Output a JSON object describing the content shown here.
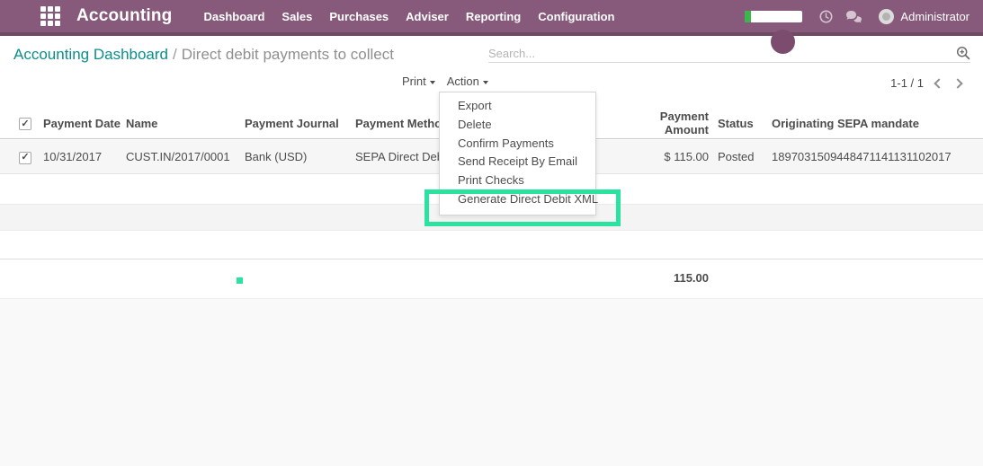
{
  "nav": {
    "brand": "Accounting",
    "items": [
      "Dashboard",
      "Sales",
      "Purchases",
      "Adviser",
      "Reporting",
      "Configuration"
    ],
    "user": "Administrator"
  },
  "breadcrumb": {
    "parent": "Accounting Dashboard",
    "separator": "/",
    "current": "Direct debit payments to collect"
  },
  "search": {
    "placeholder": "Search..."
  },
  "toolbar": {
    "print_label": "Print",
    "action_label": "Action"
  },
  "pager": {
    "range": "1-1 / 1"
  },
  "action_menu": {
    "items": [
      "Export",
      "Delete",
      "Confirm Payments",
      "Send Receipt By Email",
      "Print Checks",
      "Generate Direct Debit XML"
    ],
    "highlighted": "Generate Direct Debit XML"
  },
  "table": {
    "headers": [
      "Payment Date",
      "Name",
      "Payment Journal",
      "Payment Method",
      "Payment Amount",
      "Status",
      "Originating SEPA mandate"
    ],
    "rows": [
      {
        "payment_date": "10/31/2017",
        "name": "CUST.IN/2017/0001",
        "payment_journal": "Bank (USD)",
        "payment_method": "SEPA Direct Debit",
        "payment_amount": "$ 115.00",
        "status": "Posted",
        "mandate": "1897031509448471141131102017"
      }
    ],
    "total_amount": "115.00"
  },
  "icons": {
    "apps": "grid-3x3",
    "clock": "clock",
    "chat": "speech-bubbles",
    "zoom_in": "magnifier-plus",
    "avatar": "user-photo-placeholder"
  },
  "colors": {
    "navbar": "#875a7b",
    "navbar_border": "#6e4b62",
    "link_teal": "#0b8e8a",
    "annotation_green": "#2ae3a1",
    "annotation_purple": "#7b4c6e",
    "progress_green": "#3bb64b"
  }
}
